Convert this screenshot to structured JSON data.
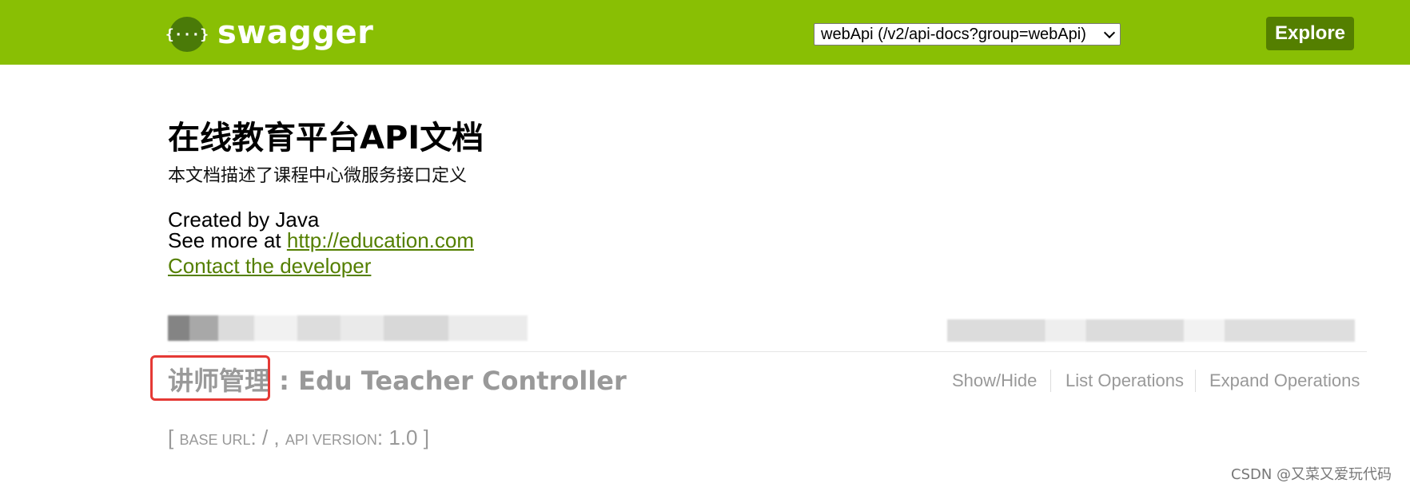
{
  "header": {
    "logo_glyph": "{···}",
    "brand": "swagger",
    "api_selector": "webApi (/v2/api-docs?group=webApi)",
    "explore_label": "Explore",
    "bar_color": "#89bf04"
  },
  "info": {
    "title": "在线教育平台API文档",
    "description": "本文档描述了课程中心微服务接口定义",
    "created_by": "Created by Java",
    "see_more_prefix": "See more at ",
    "see_more_link": "http://education.com",
    "contact_label": "Contact the developer"
  },
  "controller": {
    "name_cn": "讲师管理",
    "separator": " : ",
    "name_en": "Edu Teacher Controller",
    "actions": {
      "show_hide": "Show/Hide",
      "list_operations": "List Operations",
      "expand_operations": "Expand Operations"
    }
  },
  "footer": {
    "base_url_open": "[ ",
    "base_url_label": "BASE URL",
    "base_url_value": ": / , ",
    "api_version_label": "API VERSION",
    "api_version_value": ": 1.0 ]"
  },
  "watermark": "CSDN @又菜又爱玩代码"
}
